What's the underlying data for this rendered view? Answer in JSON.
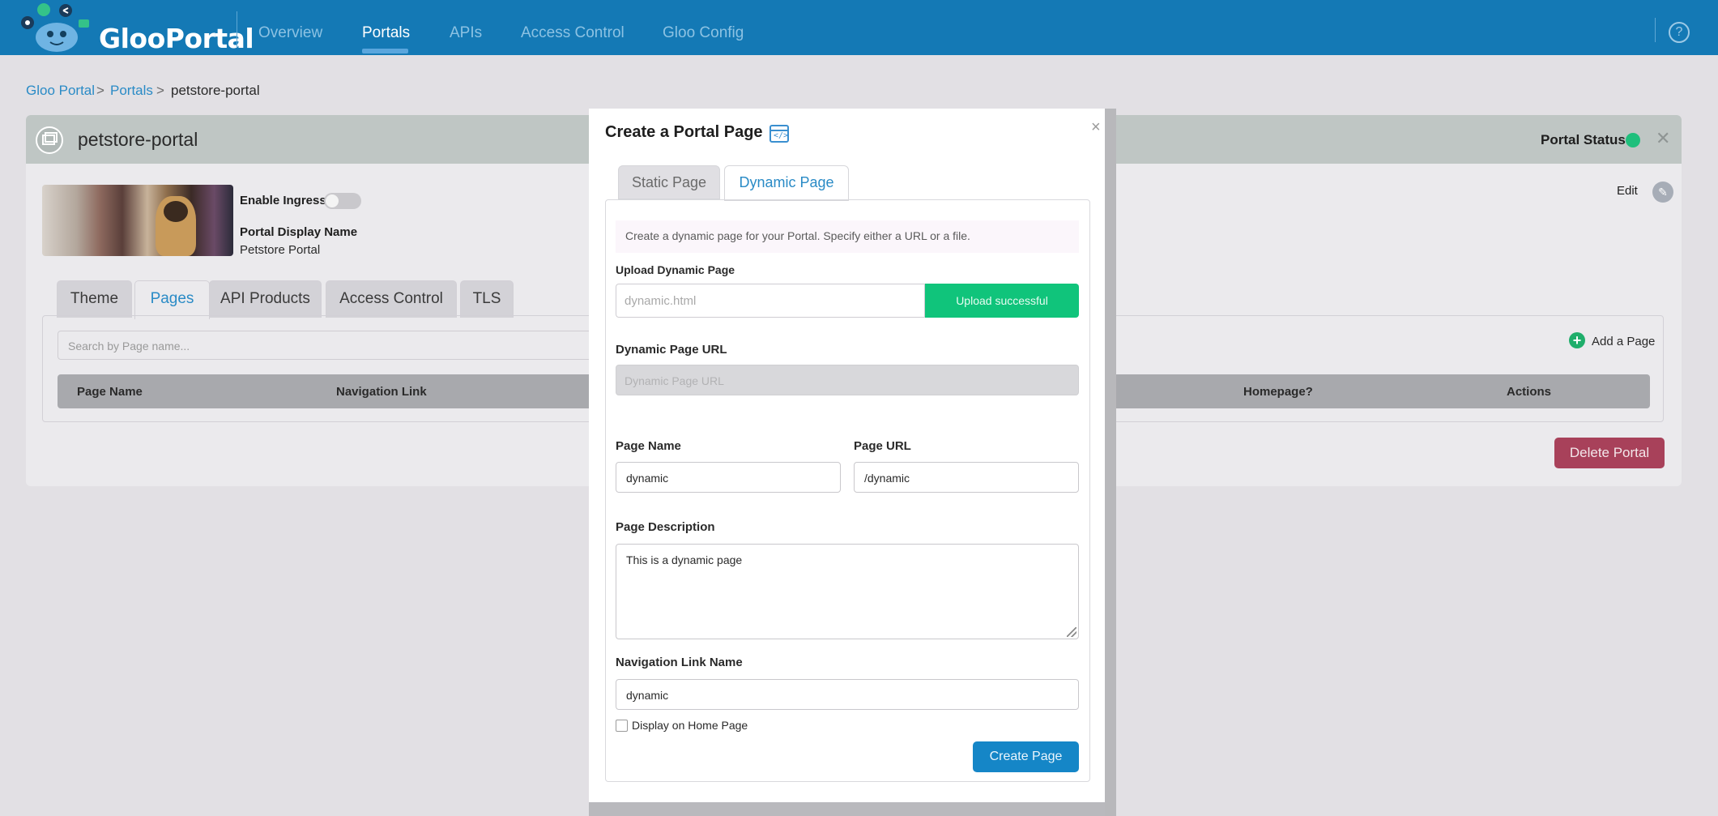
{
  "app": {
    "logo_text": "GlooPortal",
    "nav": [
      "Overview",
      "Portals",
      "APIs",
      "Access Control",
      "Gloo Config"
    ],
    "active_nav": "Portals",
    "help_icon": "?"
  },
  "breadcrumb": [
    "Gloo Portal",
    ">",
    "Portals",
    ">",
    "petstore-portal"
  ],
  "portal": {
    "title": "petstore-portal",
    "status_label": "Portal Status",
    "close": "✕",
    "enable_ingress_label": "Enable Ingress",
    "enable_ingress_on": false,
    "display_name_label": "Portal Display Name",
    "display_name": "Petstore Portal",
    "edit_label": "Edit",
    "tabs": [
      "Theme",
      "Pages",
      "API Products",
      "Access Control",
      "TLS"
    ],
    "active_tab": "Pages",
    "search_placeholder": "Search by Page name...",
    "add_page": "Add a Page",
    "columns": [
      "Page Name",
      "Navigation Link",
      "Homepage?",
      "Actions"
    ],
    "delete_button": "Delete Portal"
  },
  "modal": {
    "title": "Create a Portal Page",
    "close": "×",
    "tabs": [
      "Static Page",
      "Dynamic Page"
    ],
    "active_tab": "Dynamic Page",
    "info": "Create a dynamic page for your Portal. Specify either a URL or a file.",
    "upload_label": "Upload Dynamic Page",
    "upload_value": "dynamic.html",
    "upload_status": "Upload successful",
    "url_label": "Dynamic Page URL",
    "url_placeholder": "Dynamic Page URL",
    "page_name_label": "Page Name",
    "page_name": "dynamic",
    "page_url_label": "Page URL",
    "page_url": "/dynamic",
    "description_label": "Page Description",
    "description": "This is a dynamic page",
    "nav_link_label": "Navigation Link Name",
    "nav_link": "dynamic",
    "home_checkbox_label": "Display on Home Page",
    "home_checked": false,
    "create_button": "Create Page"
  },
  "colors": {
    "nav_bg": "#1479b5",
    "accent": "#2a8bc6",
    "success": "#10c47b",
    "danger": "#a8415a",
    "status_online": "#1fbf7c"
  },
  "icons": [
    "gear-icon",
    "share-icon",
    "help-icon",
    "portal-icon",
    "edit-icon",
    "plus-icon",
    "code-window-icon",
    "close-icon"
  ]
}
